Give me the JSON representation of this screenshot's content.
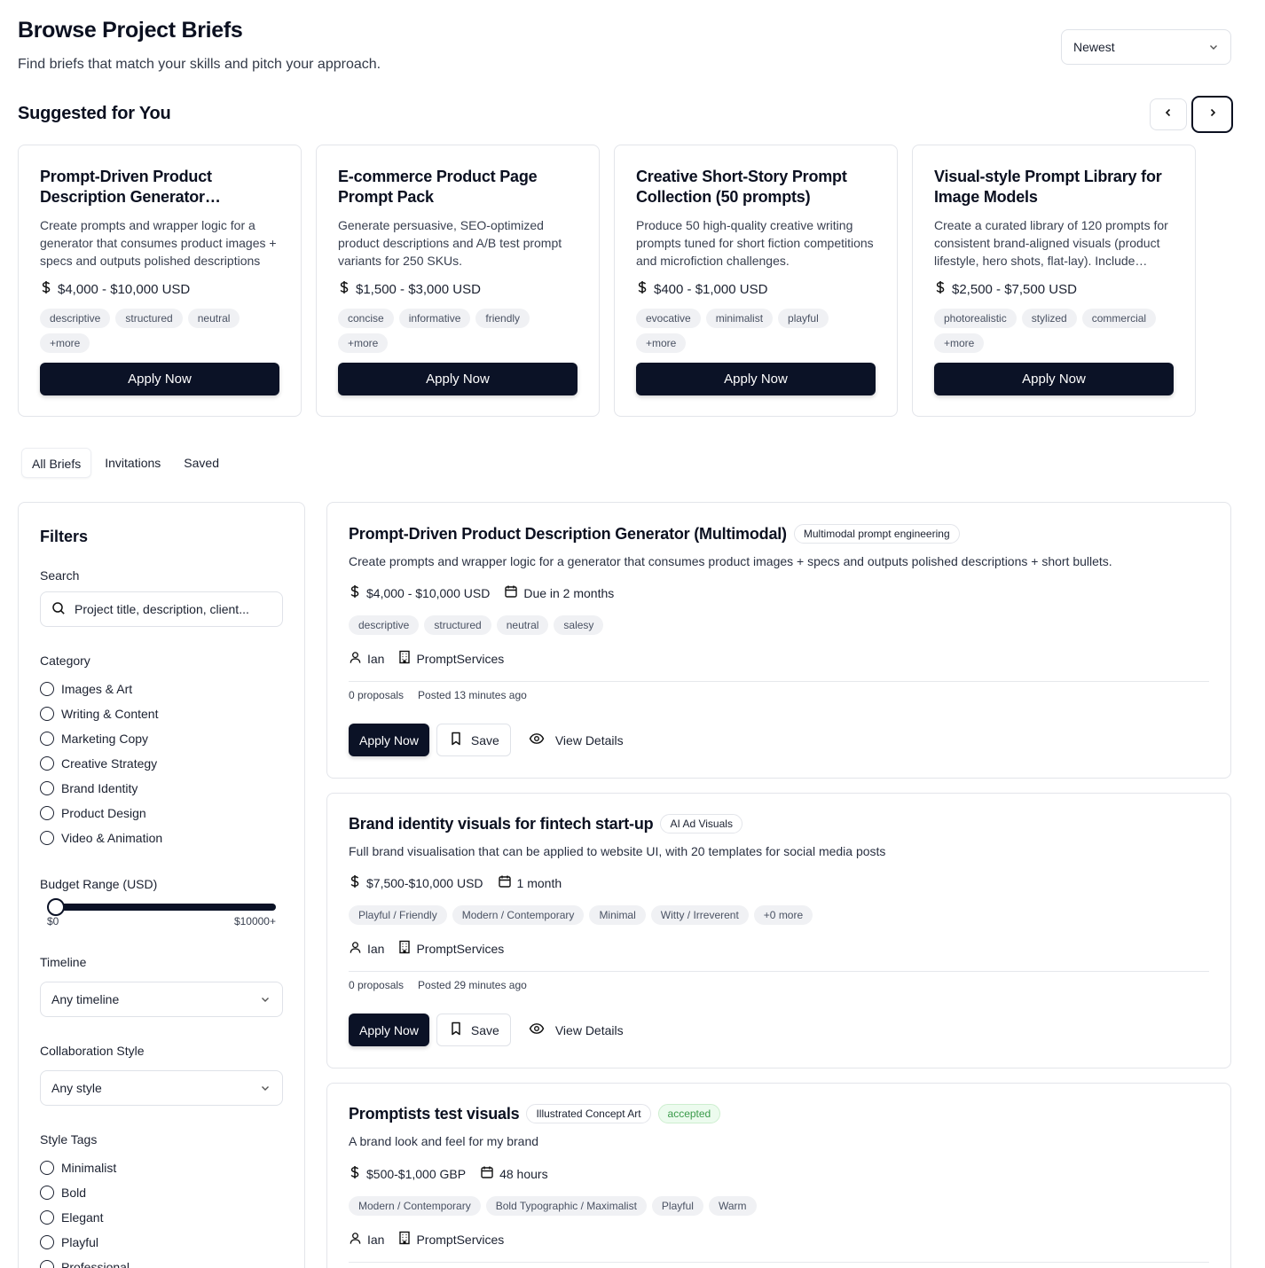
{
  "header": {
    "title": "Browse Project Briefs",
    "subtitle": "Find briefs that match your skills and pitch your approach.",
    "sort_value": "Newest"
  },
  "suggested": {
    "title": "Suggested for You",
    "cards": [
      {
        "title": "Prompt-Driven Product Description Generator…",
        "desc": "Create prompts and wrapper logic for a generator that consumes product images + specs and outputs polished descriptions +…",
        "price": "$4,000 - $10,000 USD",
        "tags": [
          "descriptive",
          "structured",
          "neutral",
          "+more"
        ],
        "cta": "Apply Now"
      },
      {
        "title": "E-commerce Product Page Prompt Pack",
        "desc": "Generate persuasive, SEO-optimized product descriptions and A/B test prompt variants for 250 SKUs.",
        "price": "$1,500 - $3,000 USD",
        "tags": [
          "concise",
          "informative",
          "friendly",
          "+more"
        ],
        "cta": "Apply Now"
      },
      {
        "title": "Creative Short-Story Prompt Collection (50 prompts)",
        "desc": "Produce 50 high-quality creative writing prompts tuned for short fiction competitions and microfiction challenges.",
        "price": "$400 - $1,000 USD",
        "tags": [
          "evocative",
          "minimalist",
          "playful",
          "+more"
        ],
        "cta": "Apply Now"
      },
      {
        "title": "Visual-style Prompt Library for Image Models",
        "desc": "Create a curated library of 120 prompts for consistent brand-aligned visuals (product lifestyle, hero shots, flat-lay). Include…",
        "price": "$2,500 - $7,500 USD",
        "tags": [
          "photorealistic",
          "stylized",
          "commercial",
          "+more"
        ],
        "cta": "Apply Now"
      }
    ]
  },
  "tabs": [
    "All Briefs",
    "Invitations",
    "Saved"
  ],
  "filters": {
    "title": "Filters",
    "search_label": "Search",
    "search_placeholder": "Project title, description, client...",
    "category_label": "Category",
    "categories": [
      "Images & Art",
      "Writing & Content",
      "Marketing Copy",
      "Creative Strategy",
      "Brand Identity",
      "Product Design",
      "Video & Animation"
    ],
    "budget_label": "Budget Range (USD)",
    "budget_min": "$0",
    "budget_max": "$10000+",
    "timeline_label": "Timeline",
    "timeline_value": "Any timeline",
    "collab_label": "Collaboration Style",
    "collab_value": "Any style",
    "style_label": "Style Tags",
    "styles": [
      "Minimalist",
      "Bold",
      "Elegant",
      "Playful",
      "Professional"
    ]
  },
  "briefs": [
    {
      "title": "Prompt-Driven Product Description Generator (Multimodal)",
      "badge": "Multimodal prompt engineering",
      "desc": "Create prompts and wrapper logic for a generator that consumes product images + specs and outputs polished descriptions + short bullets.",
      "price": "$4,000 - $10,000 USD",
      "due": "Due in 2 months",
      "tags": [
        "descriptive",
        "structured",
        "neutral",
        "salesy"
      ],
      "client": "Ian",
      "company": "PromptServices",
      "proposals": "0 proposals",
      "posted": "Posted 13 minutes ago",
      "apply": "Apply Now",
      "save": "Save",
      "view": "View Details"
    },
    {
      "title": "Brand identity visuals for fintech start-up",
      "badge": "AI Ad Visuals",
      "desc": "Full brand visualisation that can be applied to website UI, with 20 templates for social media posts",
      "price": "$7,500-$10,000 USD",
      "due": "1 month",
      "tags": [
        "Playful / Friendly",
        "Modern / Contemporary",
        "Minimal",
        "Witty / Irreverent",
        "+0 more"
      ],
      "client": "Ian",
      "company": "PromptServices",
      "proposals": "0 proposals",
      "posted": "Posted 29 minutes ago",
      "apply": "Apply Now",
      "save": "Save",
      "view": "View Details"
    },
    {
      "title": "Promptists test visuals",
      "badge": "Illustrated Concept Art",
      "status": "accepted",
      "desc": "A brand look and feel for my brand",
      "price": "$500-$1,000 GBP",
      "due": "48 hours",
      "tags": [
        "Modern / Contemporary",
        "Bold Typographic / Maximalist",
        "Playful",
        "Warm"
      ],
      "client": "Ian",
      "company": "PromptServices"
    }
  ]
}
